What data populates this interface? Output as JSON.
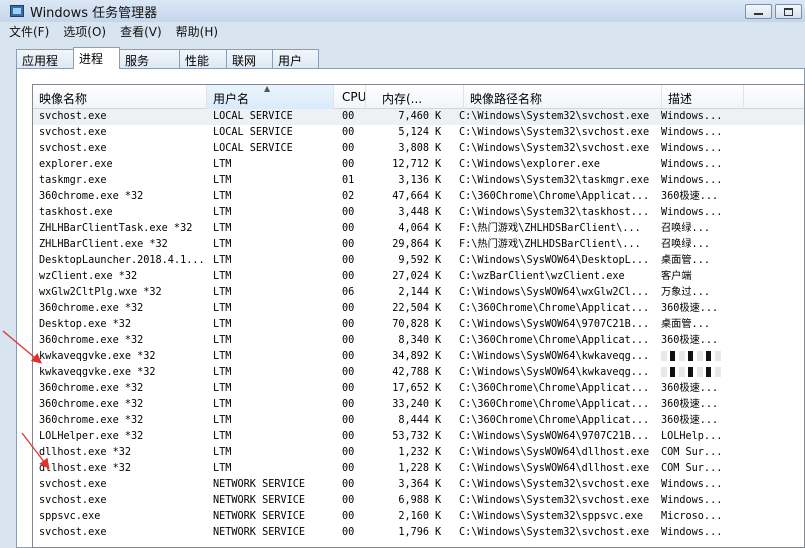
{
  "window": {
    "title": "Windows 任务管理器"
  },
  "menu": [
    "文件(F)",
    "选项(O)",
    "查看(V)",
    "帮助(H)"
  ],
  "tabs": [
    {
      "label": "应用程序",
      "active": false
    },
    {
      "label": "进程",
      "active": true
    },
    {
      "label": "服务",
      "active": false
    },
    {
      "label": "性能",
      "active": false
    },
    {
      "label": "联网",
      "active": false
    },
    {
      "label": "用户",
      "active": false
    }
  ],
  "columns": {
    "name": "映像名称",
    "user": "用户名",
    "cpu": "CPU",
    "mem": "内存(...",
    "path": "映像路径名称",
    "desc": "描述"
  },
  "rows": [
    {
      "name": "svchost.exe",
      "user": "LOCAL SERVICE",
      "cpu": "00",
      "mem": "7,460",
      "k": "K",
      "path": "C:\\Windows\\System32\\svchost.exe",
      "desc": "Windows..."
    },
    {
      "name": "svchost.exe",
      "user": "LOCAL SERVICE",
      "cpu": "00",
      "mem": "5,124",
      "k": "K",
      "path": "C:\\Windows\\System32\\svchost.exe",
      "desc": "Windows..."
    },
    {
      "name": "svchost.exe",
      "user": "LOCAL SERVICE",
      "cpu": "00",
      "mem": "3,808",
      "k": "K",
      "path": "C:\\Windows\\System32\\svchost.exe",
      "desc": "Windows..."
    },
    {
      "name": "explorer.exe",
      "user": "LTM",
      "cpu": "00",
      "mem": "12,712",
      "k": "K",
      "path": "C:\\Windows\\explorer.exe",
      "desc": "Windows..."
    },
    {
      "name": "taskmgr.exe",
      "user": "LTM",
      "cpu": "01",
      "mem": "3,136",
      "k": "K",
      "path": "C:\\Windows\\System32\\taskmgr.exe",
      "desc": "Windows..."
    },
    {
      "name": "360chrome.exe *32",
      "user": "LTM",
      "cpu": "02",
      "mem": "47,664",
      "k": "K",
      "path": "C:\\360Chrome\\Chrome\\Applicat...",
      "desc": "360极速..."
    },
    {
      "name": "taskhost.exe",
      "user": "LTM",
      "cpu": "00",
      "mem": "3,448",
      "k": "K",
      "path": "C:\\Windows\\System32\\taskhost...",
      "desc": "Windows..."
    },
    {
      "name": "ZHLHBarClientTask.exe *32",
      "user": "LTM",
      "cpu": "00",
      "mem": "4,064",
      "k": "K",
      "path": "F:\\热门游戏\\ZHLHDSBarClient\\...",
      "desc": "召唤绿..."
    },
    {
      "name": "ZHLHBarClient.exe *32",
      "user": "LTM",
      "cpu": "00",
      "mem": "29,864",
      "k": "K",
      "path": "F:\\热门游戏\\ZHLHDSBarClient\\...",
      "desc": "召唤绿..."
    },
    {
      "name": "DesktopLauncher.2018.4.1...",
      "user": "LTM",
      "cpu": "00",
      "mem": "9,592",
      "k": "K",
      "path": "C:\\Windows\\SysWOW64\\DesktopL...",
      "desc": "桌面管..."
    },
    {
      "name": "wzClient.exe *32",
      "user": "LTM",
      "cpu": "00",
      "mem": "27,024",
      "k": "K",
      "path": "C:\\wzBarClient\\wzClient.exe",
      "desc": "客户端"
    },
    {
      "name": "wxGlw2CltPlg.wxe *32",
      "user": "LTM",
      "cpu": "06",
      "mem": "2,144",
      "k": "K",
      "path": "C:\\Windows\\SysWOW64\\wxGlw2Cl...",
      "desc": "万象过..."
    },
    {
      "name": "360chrome.exe *32",
      "user": "LTM",
      "cpu": "00",
      "mem": "22,504",
      "k": "K",
      "path": "C:\\360Chrome\\Chrome\\Applicat...",
      "desc": "360极速..."
    },
    {
      "name": "Desktop.exe *32",
      "user": "LTM",
      "cpu": "00",
      "mem": "70,828",
      "k": "K",
      "path": "C:\\Windows\\SysWOW64\\9707C21B...",
      "desc": "桌面管..."
    },
    {
      "name": "360chrome.exe *32",
      "user": "LTM",
      "cpu": "00",
      "mem": "8,340",
      "k": "K",
      "path": "C:\\360Chrome\\Chrome\\Applicat...",
      "desc": "360极速..."
    },
    {
      "name": "kwkaveqgvke.exe *32",
      "user": "LTM",
      "cpu": "00",
      "mem": "34,892",
      "k": "K",
      "path": "C:\\Windows\\SysWOW64\\kwkaveqg...",
      "desc": "",
      "blurred": true
    },
    {
      "name": "kwkaveqgvke.exe *32",
      "user": "LTM",
      "cpu": "00",
      "mem": "42,788",
      "k": "K",
      "path": "C:\\Windows\\SysWOW64\\kwkaveqg...",
      "desc": "",
      "blurred": true
    },
    {
      "name": "360chrome.exe *32",
      "user": "LTM",
      "cpu": "00",
      "mem": "17,652",
      "k": "K",
      "path": "C:\\360Chrome\\Chrome\\Applicat...",
      "desc": "360极速..."
    },
    {
      "name": "360chrome.exe *32",
      "user": "LTM",
      "cpu": "00",
      "mem": "33,240",
      "k": "K",
      "path": "C:\\360Chrome\\Chrome\\Applicat...",
      "desc": "360极速..."
    },
    {
      "name": "360chrome.exe *32",
      "user": "LTM",
      "cpu": "00",
      "mem": "8,444",
      "k": "K",
      "path": "C:\\360Chrome\\Chrome\\Applicat...",
      "desc": "360极速..."
    },
    {
      "name": "LOLHelper.exe *32",
      "user": "LTM",
      "cpu": "00",
      "mem": "53,732",
      "k": "K",
      "path": "C:\\Windows\\SysWOW64\\9707C21B...",
      "desc": "LOLHelp..."
    },
    {
      "name": "dllhost.exe *32",
      "user": "LTM",
      "cpu": "00",
      "mem": "1,232",
      "k": "K",
      "path": "C:\\Windows\\SysWOW64\\dllhost.exe",
      "desc": "COM Sur..."
    },
    {
      "name": "dllhost.exe *32",
      "user": "LTM",
      "cpu": "00",
      "mem": "1,228",
      "k": "K",
      "path": "C:\\Windows\\SysWOW64\\dllhost.exe",
      "desc": "COM Sur..."
    },
    {
      "name": "svchost.exe",
      "user": "NETWORK SERVICE",
      "cpu": "00",
      "mem": "3,364",
      "k": "K",
      "path": "C:\\Windows\\System32\\svchost.exe",
      "desc": "Windows..."
    },
    {
      "name": "svchost.exe",
      "user": "NETWORK SERVICE",
      "cpu": "00",
      "mem": "6,988",
      "k": "K",
      "path": "C:\\Windows\\System32\\svchost.exe",
      "desc": "Windows..."
    },
    {
      "name": "sppsvc.exe",
      "user": "NETWORK SERVICE",
      "cpu": "00",
      "mem": "2,160",
      "k": "K",
      "path": "C:\\Windows\\System32\\sppsvc.exe",
      "desc": "Microso..."
    },
    {
      "name": "svchost.exe",
      "user": "NETWORK SERVICE",
      "cpu": "00",
      "mem": "1,796",
      "k": "K",
      "path": "C:\\Windows\\System32\\svchost.exe",
      "desc": "Windows..."
    }
  ],
  "colors": {
    "annotation_arrow": "#e0342a",
    "window_bg": "#d9e4f1"
  }
}
